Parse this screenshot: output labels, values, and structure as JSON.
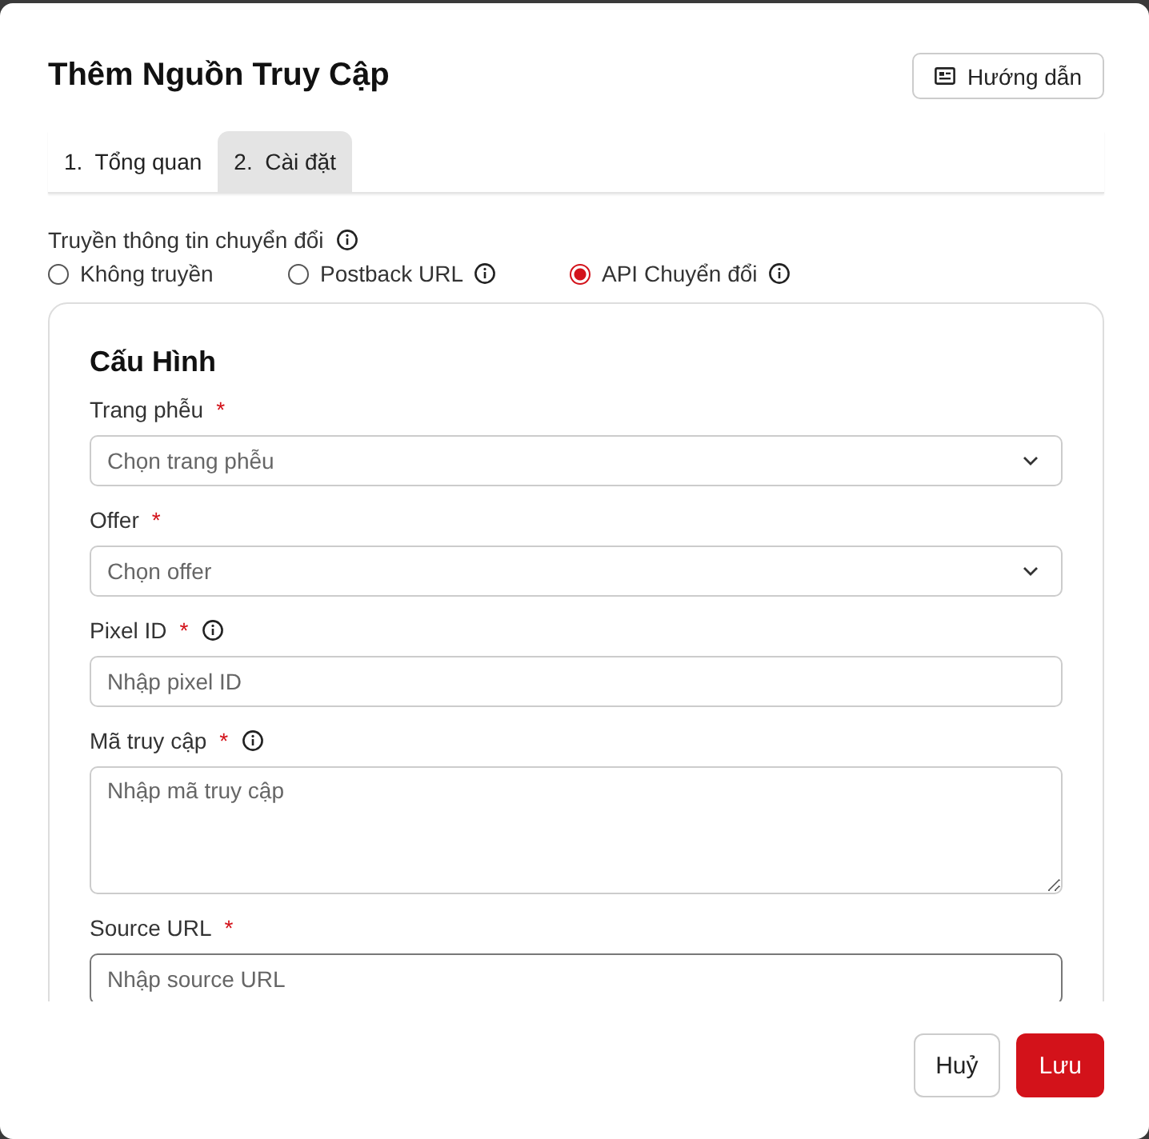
{
  "dialog": {
    "title": "Thêm Nguồn Truy Cập",
    "guide_button": "Hướng dẫn"
  },
  "tabs": [
    {
      "label": "1.  Tổng quan",
      "selected": false
    },
    {
      "label": "2.  Cài đặt",
      "selected": true
    }
  ],
  "conversion": {
    "label": "Truyền thông tin chuyển đổi",
    "info": true,
    "options": [
      {
        "label": "Không truyền",
        "selected": false,
        "info": false
      },
      {
        "label": "Postback URL",
        "selected": false,
        "info": true
      },
      {
        "label": "API Chuyển đổi",
        "selected": true,
        "info": true
      }
    ]
  },
  "config": {
    "heading": "Cấu Hình",
    "fields": [
      {
        "kind": "select",
        "label": "Trang phễu",
        "required_mark": "*",
        "info": false,
        "placeholder": "Chọn trang phễu",
        "focused": false
      },
      {
        "kind": "select",
        "label": "Offer",
        "required_mark": "*",
        "info": false,
        "placeholder": "Chọn offer",
        "focused": false
      },
      {
        "kind": "input",
        "label": "Pixel ID",
        "required_mark": "*",
        "info": true,
        "placeholder": "Nhập pixel ID",
        "focused": false
      },
      {
        "kind": "textarea",
        "label": "Mã truy cập",
        "required_mark": "*",
        "info": true,
        "placeholder": "Nhập mã truy cập",
        "focused": false
      },
      {
        "kind": "input",
        "label": "Source URL",
        "required_mark": "*",
        "info": false,
        "placeholder": "Nhập source URL",
        "focused": true
      }
    ]
  },
  "footer": {
    "buttons": [
      {
        "label": "Huỷ",
        "kind": "secondary"
      },
      {
        "label": "Lưu",
        "kind": "primary"
      }
    ]
  }
}
